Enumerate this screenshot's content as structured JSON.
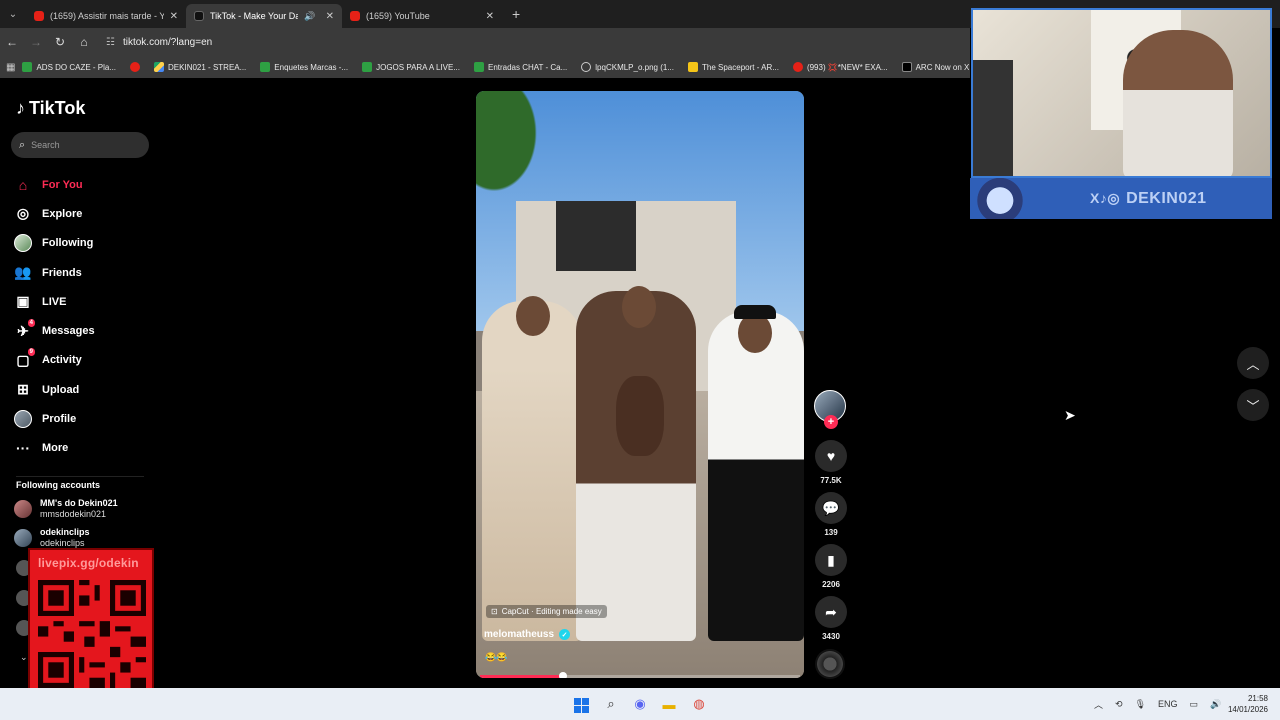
{
  "browser": {
    "tabs": [
      {
        "title": "(1659) Assistir mais tarde - YouT",
        "favicon": "youtube-icon",
        "active": false
      },
      {
        "title": "TikTok - Make Your Day",
        "favicon": "tiktok-icon",
        "active": true,
        "audio": true
      },
      {
        "title": "(1659) YouTube",
        "favicon": "youtube-icon",
        "active": false
      }
    ],
    "url": "tiktok.com/?lang=en",
    "bookmarks": [
      {
        "label": "ADS DO CAZE - Pla...",
        "icon": "sheets-icon"
      },
      {
        "label": "",
        "icon": "youtube-icon"
      },
      {
        "label": "DEKIN021 - STREA...",
        "icon": "drive-icon"
      },
      {
        "label": "Enquetes Marcas -...",
        "icon": "sheets-icon"
      },
      {
        "label": "JOGOS PARA A LIVE...",
        "icon": "sheets-icon"
      },
      {
        "label": "Entradas CHAT - Ca...",
        "icon": "sheets-icon"
      },
      {
        "label": "lpqCKMLP_o.png (1...",
        "icon": "globe-icon"
      },
      {
        "label": "The Spaceport - AR...",
        "icon": "y-icon"
      },
      {
        "label": "(993) 💢*NEW* EXA...",
        "icon": "youtube-icon"
      },
      {
        "label": "ARC Now on X: \"Co...",
        "icon": "x-icon"
      }
    ]
  },
  "tiktok": {
    "logo": "TikTok",
    "search_placeholder": "Search",
    "nav": [
      {
        "label": "For You",
        "icon": "home-icon",
        "active": true
      },
      {
        "label": "Explore",
        "icon": "compass-icon"
      },
      {
        "label": "Following",
        "icon": "following-avatar"
      },
      {
        "label": "Friends",
        "icon": "friends-icon"
      },
      {
        "label": "LIVE",
        "icon": "live-icon"
      },
      {
        "label": "Messages",
        "icon": "messages-icon",
        "badge": "4"
      },
      {
        "label": "Activity",
        "icon": "activity-icon",
        "badge": "9"
      },
      {
        "label": "Upload",
        "icon": "upload-icon"
      },
      {
        "label": "Profile",
        "icon": "profile-avatar"
      },
      {
        "label": "More",
        "icon": "more-icon"
      }
    ],
    "following_title": "Following accounts",
    "following": [
      {
        "name": "MM's do Dekin021",
        "handle": "mmsdodekin021"
      },
      {
        "name": "odekinclips",
        "handle": "odekinclips"
      }
    ],
    "overlay_qr_text": "livepix.gg/odekin",
    "video": {
      "capcut_label": "CapCut · Editing made easy",
      "author": "melomatheuss",
      "description": "😂😂",
      "progress": 0.26
    },
    "actions": {
      "likes": "77.5K",
      "comments": "139",
      "saves": "2206",
      "shares": "3430"
    }
  },
  "stream_overlay": {
    "handle": "DEKIN021",
    "socials": "X♪◎"
  },
  "taskbar": {
    "language": "ENG",
    "time": "21:58",
    "date": "14/01/2026"
  }
}
